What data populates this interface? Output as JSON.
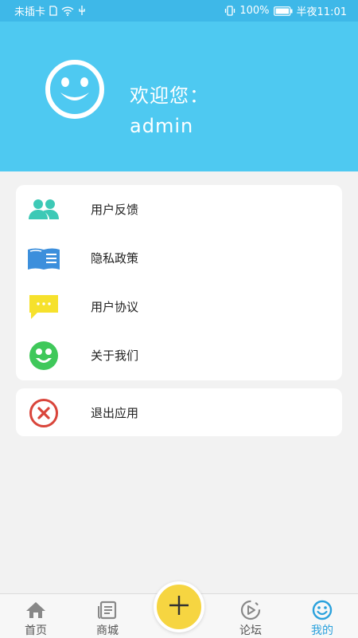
{
  "status_bar": {
    "carrier": "未插卡",
    "battery": "100%",
    "time": "半夜11:01"
  },
  "header": {
    "welcome": "欢迎您：",
    "username": "admin",
    "avatar_icon": "smiley-face-icon"
  },
  "menu": {
    "items": [
      {
        "label": "用户反馈",
        "icon": "users-icon",
        "color": "#3dc9b6"
      },
      {
        "label": "隐私政策",
        "icon": "open-book-icon",
        "color": "#3c8fdc"
      },
      {
        "label": "用户协议",
        "icon": "chat-bubble-icon",
        "color": "#f6e12c"
      },
      {
        "label": "关于我们",
        "icon": "about-face-icon",
        "color": "#3fc85a"
      }
    ]
  },
  "exit": {
    "label": "退出应用",
    "icon": "close-circle-icon",
    "color": "#d9453b"
  },
  "tabbar": {
    "tabs": [
      {
        "label": "首页",
        "icon": "home-icon"
      },
      {
        "label": "商城",
        "icon": "store-icon"
      },
      {
        "label": "论坛",
        "icon": "play-circle-icon"
      },
      {
        "label": "我的",
        "icon": "smiley-icon"
      }
    ],
    "active_index": 3,
    "fab_icon": "plus-icon",
    "active_color": "#2aa1dc"
  }
}
